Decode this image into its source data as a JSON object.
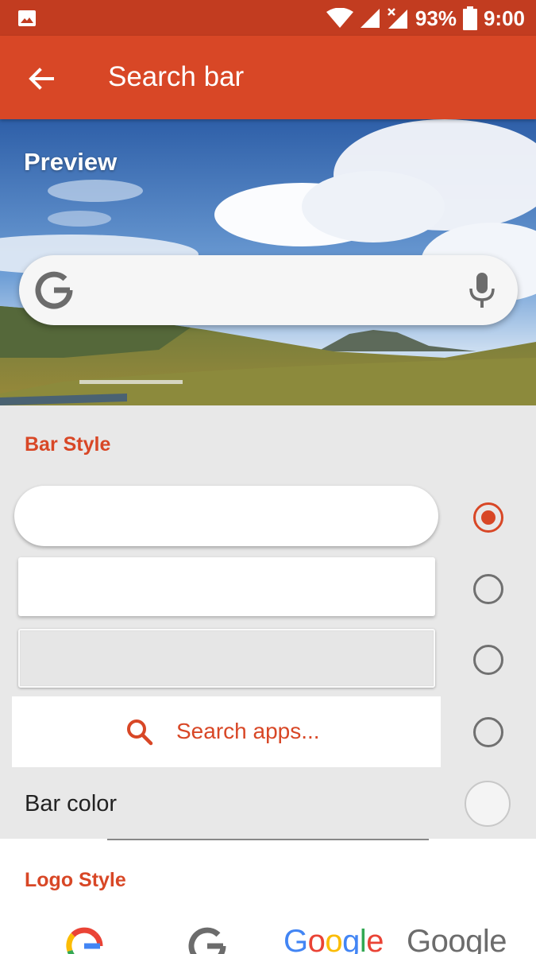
{
  "status_bar": {
    "battery": "93%",
    "time": "9:00",
    "icons": [
      "gallery-icon",
      "wifi-icon",
      "signal-icon",
      "signal-no-data-icon",
      "battery-icon"
    ]
  },
  "app_bar": {
    "back_icon": "arrow-left-icon",
    "title": "Search bar"
  },
  "preview": {
    "label": "Preview",
    "search_bar": {
      "logo": "google-g-icon",
      "mic": "microphone-icon"
    }
  },
  "bar_style": {
    "title": "Bar Style",
    "options": [
      {
        "style": "pill",
        "selected": true
      },
      {
        "style": "rectangle",
        "selected": false
      },
      {
        "style": "outlined",
        "selected": false
      },
      {
        "style": "flat",
        "label": "Search apps...",
        "icon": "search-icon",
        "selected": false
      }
    ]
  },
  "bar_color": {
    "label": "Bar color",
    "value": "#f4f4f4"
  },
  "logo_style": {
    "title": "Logo Style",
    "options": [
      {
        "type": "g-color",
        "text": "G"
      },
      {
        "type": "g-gray",
        "text": "G"
      },
      {
        "type": "word-color",
        "text": "Google"
      },
      {
        "type": "word-gray",
        "text": "Google"
      }
    ]
  },
  "colors": {
    "primary": "#d84726",
    "status_bar": "#c23c20",
    "background": "#e8e8e8",
    "google_blue": "#4285f4",
    "google_red": "#ea4335",
    "google_yellow": "#fbbc05",
    "google_green": "#34a853"
  }
}
